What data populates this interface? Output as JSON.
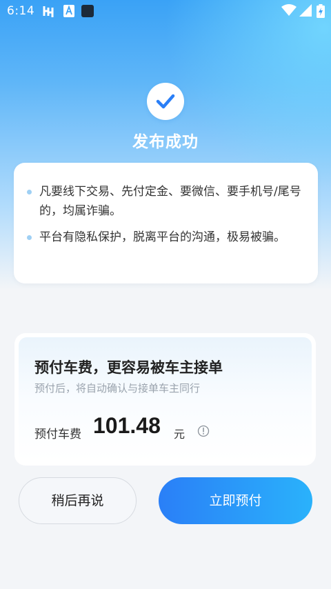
{
  "status_bar": {
    "time": "6:14",
    "icons": [
      "sync-icon",
      "font-a-icon",
      "app-square-icon",
      "wifi-icon",
      "signal-icon",
      "battery-charging-icon"
    ]
  },
  "header": {
    "icon": "check-icon",
    "title": "发布成功"
  },
  "warning_card": {
    "tips": [
      "凡要线下交易、先付定金、要微信、要手机号/尾号的，均属诈骗。",
      "平台有隐私保护，脱离平台的沟通，极易被骗。"
    ]
  },
  "prepay_card": {
    "title": "预付车费，更容易被车主接单",
    "subtitle": "预付后，将自动确认与接单车主同行",
    "fee_label": "预付车费",
    "fee_amount": "101.48",
    "fee_unit": "元",
    "info_icon": "info-icon"
  },
  "buttons": {
    "later": "稍后再说",
    "prepay": "立即预付"
  },
  "colors": {
    "accent": "#2a7ff7",
    "accent_end": "#2ab2fb",
    "hero_top": "#3aa2f6",
    "tip_dot": "#9fd0f4"
  }
}
